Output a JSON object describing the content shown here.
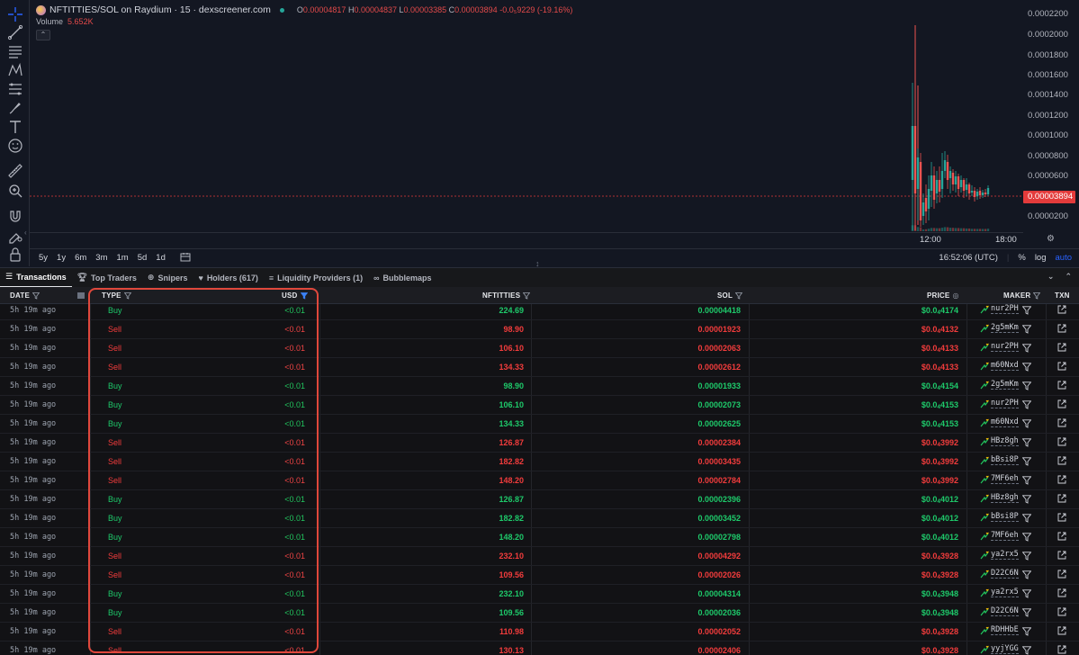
{
  "chart": {
    "pair_title": "NFTITTIES/SOL on Raydium · 15 · dexscreener.com",
    "ohlc": {
      "o_label": "O",
      "o": "0.00004817",
      "h_label": "H",
      "h": "0.00004837",
      "l_label": "L",
      "l": "0.00003385",
      "c_label": "C",
      "c": "0.00003894",
      "change": "-0.0₅9229 (-19.16%)"
    },
    "volume_label": "Volume",
    "volume_value": "5.652K",
    "price_axis": [
      "0.0002200",
      "0.0002000",
      "0.0001800",
      "0.0001600",
      "0.0001400",
      "0.0001200",
      "0.0001000",
      "0.0000800",
      "0.0000600",
      "0.0000400",
      "0.0000200"
    ],
    "last_price": "0.00003894",
    "time_labels": [
      "12:00",
      "18:00"
    ],
    "ranges": [
      "5y",
      "1y",
      "6m",
      "3m",
      "1m",
      "5d",
      "1d"
    ],
    "clock": "16:52:06 (UTC)",
    "scale_pct": "%",
    "scale_log": "log",
    "scale_auto": "auto",
    "colors": {
      "up": "#26a69a",
      "down": "#ef5350",
      "last_price_line": "#e33b3b"
    }
  },
  "tabs": [
    {
      "label": "Transactions",
      "icon": "list-icon",
      "active": true
    },
    {
      "label": "Top Traders",
      "icon": "trophy-icon"
    },
    {
      "label": "Snipers",
      "icon": "crosshair-icon"
    },
    {
      "label": "Holders (617)",
      "icon": "heart-icon"
    },
    {
      "label": "Liquidity Providers (1)",
      "icon": "layers-icon"
    },
    {
      "label": "Bubblemaps",
      "icon": "bubbles-icon"
    }
  ],
  "table": {
    "headers": {
      "date": "DATE",
      "type": "TYPE",
      "usd": "USD",
      "nft": "NFTITTIES",
      "sol": "SOL",
      "price": "PRICE",
      "maker": "MAKER",
      "txn": "TXN"
    },
    "rows": [
      {
        "date": "5h 19m ago",
        "type": "Buy",
        "usd": "<0.01",
        "nft": "224.69",
        "sol": "0.00004418",
        "price_pre": "$0.0",
        "price_sub": "4",
        "price_post": "4174",
        "maker": "nur2PH"
      },
      {
        "date": "5h 19m ago",
        "type": "Sell",
        "usd": "<0.01",
        "nft": "98.90",
        "sol": "0.00001923",
        "price_pre": "$0.0",
        "price_sub": "4",
        "price_post": "4132",
        "maker": "2g5mKm"
      },
      {
        "date": "5h 19m ago",
        "type": "Sell",
        "usd": "<0.01",
        "nft": "106.10",
        "sol": "0.00002063",
        "price_pre": "$0.0",
        "price_sub": "4",
        "price_post": "4133",
        "maker": "nur2PH"
      },
      {
        "date": "5h 19m ago",
        "type": "Sell",
        "usd": "<0.01",
        "nft": "134.33",
        "sol": "0.00002612",
        "price_pre": "$0.0",
        "price_sub": "4",
        "price_post": "4133",
        "maker": "m60Nxd"
      },
      {
        "date": "5h 19m ago",
        "type": "Buy",
        "usd": "<0.01",
        "nft": "98.90",
        "sol": "0.00001933",
        "price_pre": "$0.0",
        "price_sub": "4",
        "price_post": "4154",
        "maker": "2g5mKm"
      },
      {
        "date": "5h 19m ago",
        "type": "Buy",
        "usd": "<0.01",
        "nft": "106.10",
        "sol": "0.00002073",
        "price_pre": "$0.0",
        "price_sub": "4",
        "price_post": "4153",
        "maker": "nur2PH"
      },
      {
        "date": "5h 19m ago",
        "type": "Buy",
        "usd": "<0.01",
        "nft": "134.33",
        "sol": "0.00002625",
        "price_pre": "$0.0",
        "price_sub": "4",
        "price_post": "4153",
        "maker": "m60Nxd"
      },
      {
        "date": "5h 19m ago",
        "type": "Sell",
        "usd": "<0.01",
        "nft": "126.87",
        "sol": "0.00002384",
        "price_pre": "$0.0",
        "price_sub": "4",
        "price_post": "3992",
        "maker": "HBz8gh"
      },
      {
        "date": "5h 19m ago",
        "type": "Sell",
        "usd": "<0.01",
        "nft": "182.82",
        "sol": "0.00003435",
        "price_pre": "$0.0",
        "price_sub": "4",
        "price_post": "3992",
        "maker": "bBsi8P"
      },
      {
        "date": "5h 19m ago",
        "type": "Sell",
        "usd": "<0.01",
        "nft": "148.20",
        "sol": "0.00002784",
        "price_pre": "$0.0",
        "price_sub": "4",
        "price_post": "3992",
        "maker": "7MF6eh"
      },
      {
        "date": "5h 19m ago",
        "type": "Buy",
        "usd": "<0.01",
        "nft": "126.87",
        "sol": "0.00002396",
        "price_pre": "$0.0",
        "price_sub": "4",
        "price_post": "4012",
        "maker": "HBz8gh"
      },
      {
        "date": "5h 19m ago",
        "type": "Buy",
        "usd": "<0.01",
        "nft": "182.82",
        "sol": "0.00003452",
        "price_pre": "$0.0",
        "price_sub": "4",
        "price_post": "4012",
        "maker": "bBsi8P"
      },
      {
        "date": "5h 19m ago",
        "type": "Buy",
        "usd": "<0.01",
        "nft": "148.20",
        "sol": "0.00002798",
        "price_pre": "$0.0",
        "price_sub": "4",
        "price_post": "4012",
        "maker": "7MF6eh"
      },
      {
        "date": "5h 19m ago",
        "type": "Sell",
        "usd": "<0.01",
        "nft": "232.10",
        "sol": "0.00004292",
        "price_pre": "$0.0",
        "price_sub": "4",
        "price_post": "3928",
        "maker": "ya2rx5"
      },
      {
        "date": "5h 19m ago",
        "type": "Sell",
        "usd": "<0.01",
        "nft": "109.56",
        "sol": "0.00002026",
        "price_pre": "$0.0",
        "price_sub": "4",
        "price_post": "3928",
        "maker": "D22C6N"
      },
      {
        "date": "5h 19m ago",
        "type": "Buy",
        "usd": "<0.01",
        "nft": "232.10",
        "sol": "0.00004314",
        "price_pre": "$0.0",
        "price_sub": "4",
        "price_post": "3948",
        "maker": "ya2rx5"
      },
      {
        "date": "5h 19m ago",
        "type": "Buy",
        "usd": "<0.01",
        "nft": "109.56",
        "sol": "0.00002036",
        "price_pre": "$0.0",
        "price_sub": "4",
        "price_post": "3948",
        "maker": "D22C6N"
      },
      {
        "date": "5h 19m ago",
        "type": "Sell",
        "usd": "<0.01",
        "nft": "110.98",
        "sol": "0.00002052",
        "price_pre": "$0.0",
        "price_sub": "4",
        "price_post": "3928",
        "maker": "RDHHbE"
      },
      {
        "date": "5h 19m ago",
        "type": "Sell",
        "usd": "<0.01",
        "nft": "130.13",
        "sol": "0.00002406",
        "price_pre": "$0.0",
        "price_sub": "4",
        "price_post": "3928",
        "maker": "yyjYGG"
      }
    ]
  }
}
